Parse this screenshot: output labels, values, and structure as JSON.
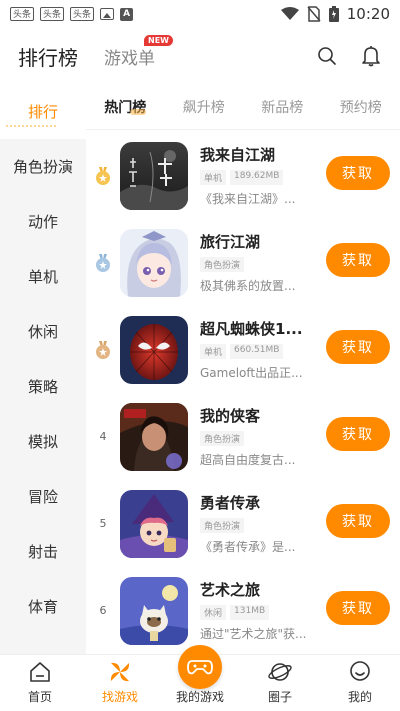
{
  "status_bar": {
    "time": "10:20",
    "notif_chips": [
      "头条",
      "头条",
      "头条"
    ]
  },
  "header": {
    "title": "排行榜",
    "tab2": "游戏单",
    "new_badge": "NEW"
  },
  "sidebar": {
    "items": [
      "排行",
      "角色扮演",
      "动作",
      "单机",
      "休闲",
      "策略",
      "模拟",
      "冒险",
      "射击",
      "体育"
    ]
  },
  "subtabs": [
    "热门榜",
    "飙升榜",
    "新品榜",
    "预约榜"
  ],
  "games": [
    {
      "rank": "1",
      "name": "我来自江湖",
      "tags": [
        "单机",
        "189.62MB"
      ],
      "desc": "《我来自江湖》...",
      "button": "获取"
    },
    {
      "rank": "2",
      "name": "旅行江湖",
      "tags": [
        "角色扮演"
      ],
      "desc": "极其佛系的放置...",
      "button": "获取"
    },
    {
      "rank": "3",
      "name": "超凡蜘蛛侠1...",
      "tags": [
        "单机",
        "660.51MB"
      ],
      "desc": "Gameloft出品正...",
      "button": "获取"
    },
    {
      "rank": "4",
      "name": "我的侠客",
      "tags": [
        "角色扮演"
      ],
      "desc": "超高自由度复古...",
      "button": "获取"
    },
    {
      "rank": "5",
      "name": "勇者传承",
      "tags": [
        "角色扮演"
      ],
      "desc": "《勇者传承》是...",
      "button": "获取"
    },
    {
      "rank": "6",
      "name": "艺术之旅",
      "tags": [
        "休闲",
        "131MB"
      ],
      "desc": "通过\"艺术之旅\"获...",
      "button": "获取"
    }
  ],
  "bottom_nav": [
    "首页",
    "找游戏",
    "我的游戏",
    "圈子",
    "我的"
  ],
  "colors": {
    "accent": "#ff8a00",
    "gold": "#f2b53a",
    "silver": "#8fb6d9",
    "bronze": "#d9a56b"
  }
}
